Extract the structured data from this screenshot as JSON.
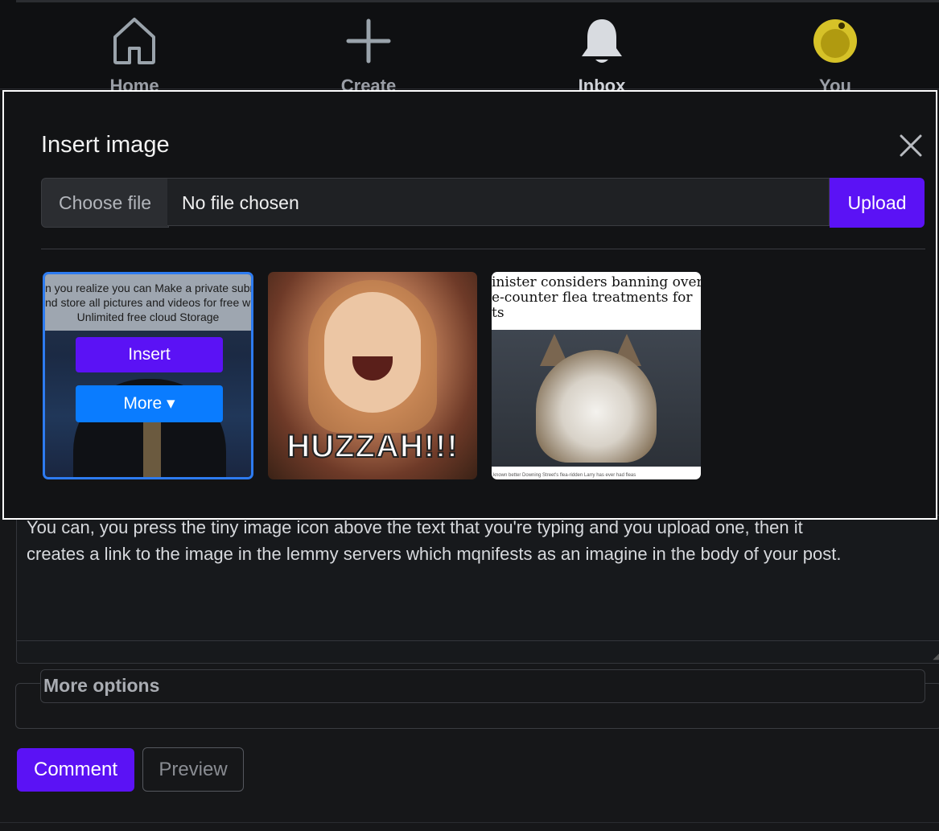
{
  "nav": {
    "items": [
      {
        "label": "Home",
        "icon": "home-icon"
      },
      {
        "label": "Create",
        "icon": "plus-icon"
      },
      {
        "label": "Inbox",
        "icon": "bell-icon"
      },
      {
        "label": "You",
        "icon": "avatar"
      }
    ]
  },
  "modal": {
    "title": "Insert image",
    "file": {
      "choose_label": "Choose file",
      "status": "No file chosen",
      "upload_label": "Upload"
    },
    "thumbs": [
      {
        "caption_lines": [
          "n you realize you can Make a private subr",
          "nd store all pictures and videos for free wi",
          "Unlimited free cloud Storage"
        ],
        "insert_label": "Insert",
        "more_label": "More ▾"
      },
      {
        "text": "HUZZAH!!!"
      },
      {
        "headline_lines": [
          "inister considers banning over",
          "e-counter flea treatments for",
          "ts"
        ],
        "credit": "known better Downing Street's flea-ridden Larry has ever had fleas"
      }
    ]
  },
  "editor": {
    "line1": "You can, you press the tiny image icon above the text that you're typing and you upload one, then it",
    "line2": "creates a link to the image in the lemmy servers which mqnifests as an imagine in the body of your post."
  },
  "more_options_label": "More options",
  "actions": {
    "comment_label": "Comment",
    "preview_label": "Preview"
  },
  "colors": {
    "accent": "#5b12f5",
    "selection_border": "#2d7bf0",
    "more_button": "#0a7cff",
    "background": "#161719"
  }
}
